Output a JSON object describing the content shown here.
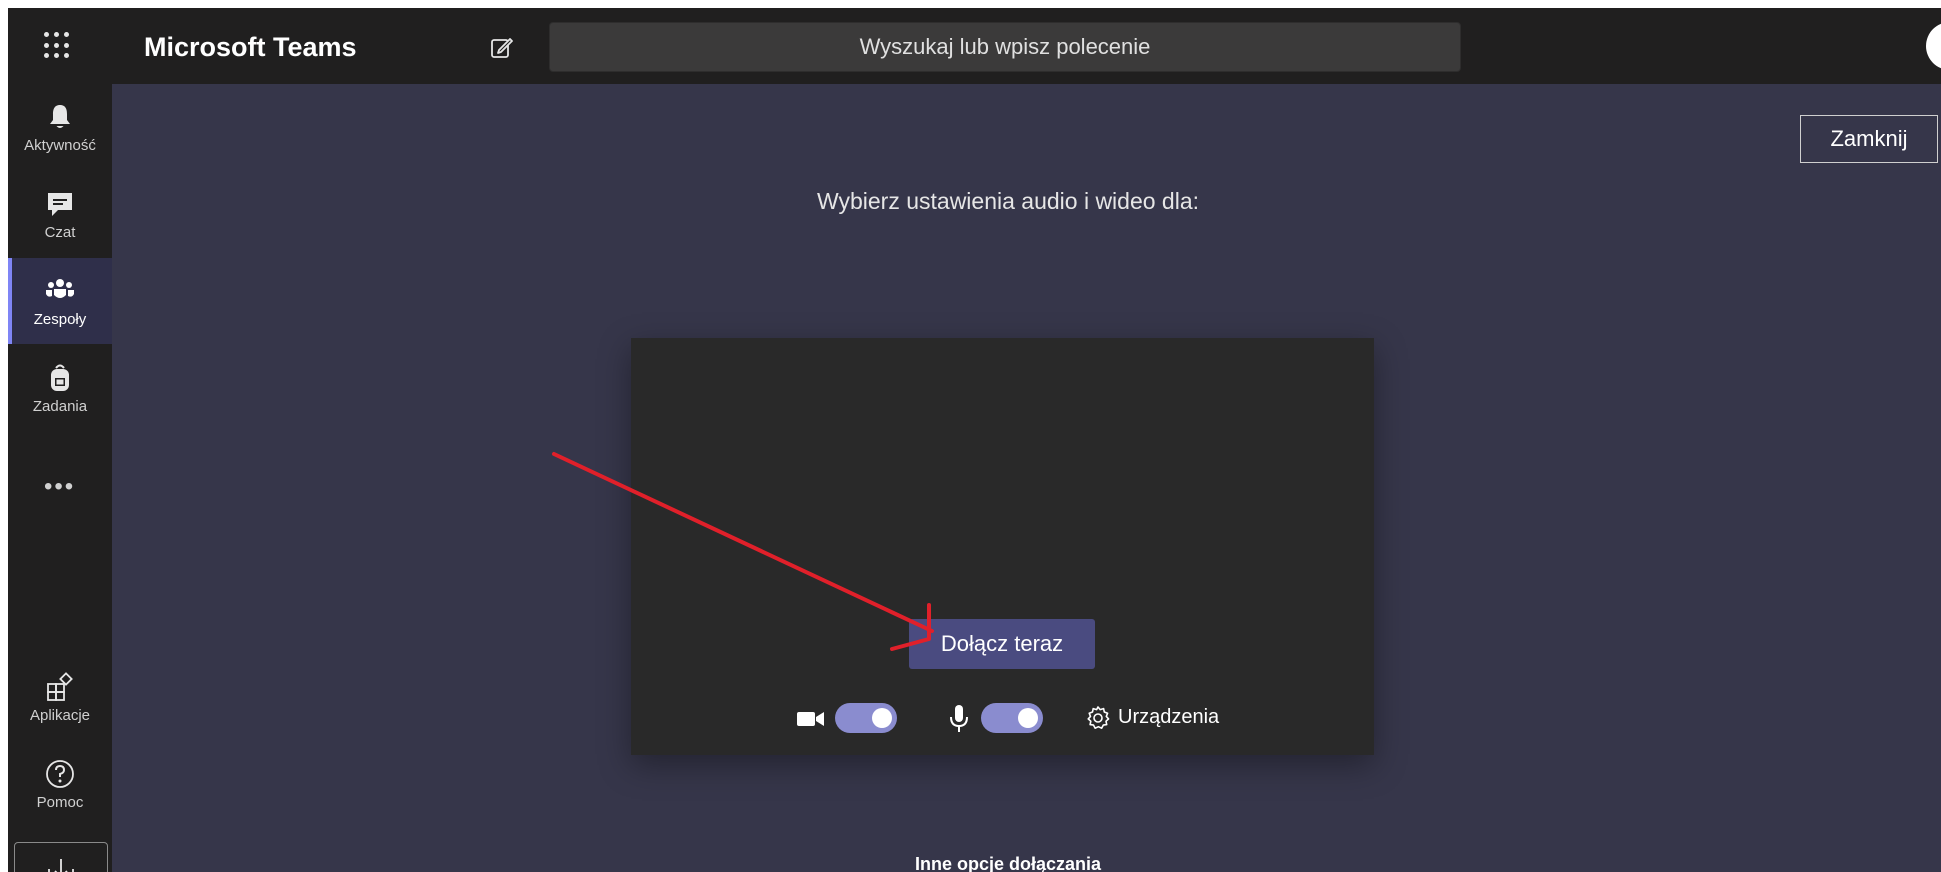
{
  "topbar": {
    "app_title": "Microsoft Teams",
    "search_placeholder": "Wyszukaj lub wpisz polecenie"
  },
  "rail": {
    "items": [
      {
        "label": "Aktywność",
        "icon": "bell-icon"
      },
      {
        "label": "Czat",
        "icon": "chat-icon"
      },
      {
        "label": "Zespoły",
        "icon": "teams-icon",
        "active": true
      },
      {
        "label": "Zadania",
        "icon": "backpack-icon"
      },
      {
        "label": "Aplikacje",
        "icon": "apps-icon"
      },
      {
        "label": "Pomoc",
        "icon": "help-icon"
      }
    ],
    "more_label": "•••"
  },
  "main": {
    "close_label": "Zamknij",
    "heading": "Wybierz ustawienia audio i wideo dla:",
    "join_label": "Dołącz teraz",
    "devices_label": "Urządzenia",
    "camera_on": true,
    "mic_on": true,
    "other_options_label": "Inne opcje dołączania"
  },
  "colors": {
    "accent": "#4a4b80",
    "toggle": "#8a8ccf",
    "annotation_arrow": "#e0202a"
  }
}
